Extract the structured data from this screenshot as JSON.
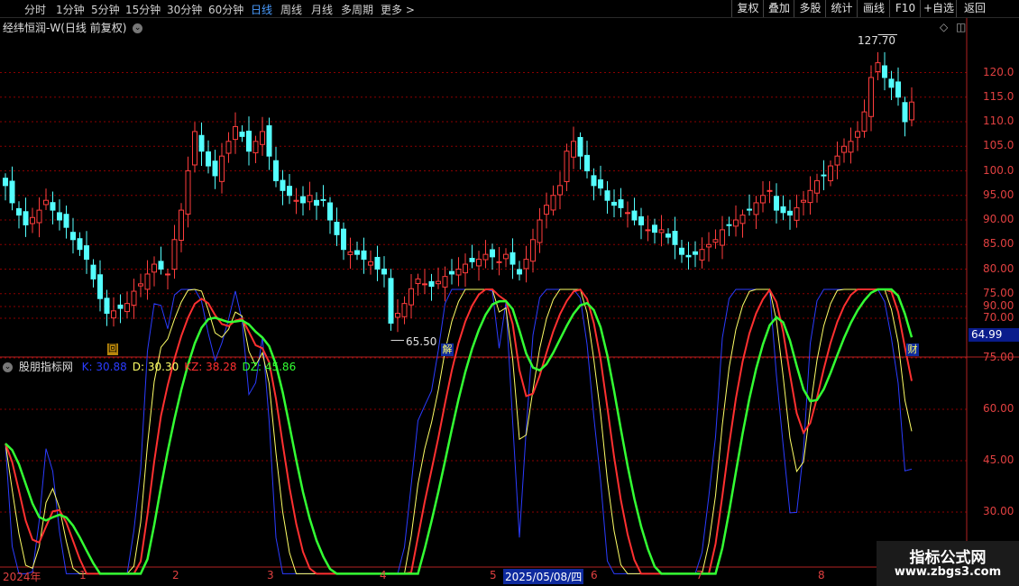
{
  "toolbar": {
    "periods": [
      "分时",
      "1分钟",
      "5分钟",
      "15分钟",
      "30分钟",
      "60分钟",
      "日线",
      "周线",
      "月线",
      "多周期",
      "更多 >"
    ],
    "active_period": "日线",
    "right_buttons": [
      "复权",
      "叠加",
      "多股",
      "统计",
      "画线",
      "F10",
      "+自选",
      "返回"
    ]
  },
  "main_panel": {
    "title": "经纬恒润-W(日线 前复权)",
    "high_marker": "127.70",
    "low_marker": "65.50",
    "current_price": "64.99",
    "price_ticks": [
      "120.0",
      "115.0",
      "110.0",
      "105.0",
      "100.0",
      "95.00",
      "90.00",
      "85.00",
      "80.00",
      "75.00",
      "70.00"
    ],
    "event_markers": [
      "回",
      "解",
      "财"
    ]
  },
  "indicator_panel": {
    "name": "股朋指标网",
    "values": [
      {
        "label": "K: 30.88",
        "color": "#2b3cff"
      },
      {
        "label": "D: 30.30",
        "color": "#ffff66"
      },
      {
        "label": "KZ: 38.28",
        "color": "#ff3030"
      },
      {
        "label": "DZ: 45.86",
        "color": "#33ff33"
      }
    ],
    "ticks": [
      "90.00",
      "75.00",
      "60.00",
      "45.00",
      "30.00"
    ]
  },
  "date_axis": {
    "labels": [
      "2024年",
      "1",
      "2",
      "3",
      "4",
      "5",
      "2025/05/08/四",
      "6",
      "7",
      "8"
    ]
  },
  "watermark": {
    "line1": "指标公式网",
    "line2": "www.zbgs3.com"
  },
  "colors": {
    "up": "#ff3d3d",
    "down": "#54ffff",
    "grid": "#8b0000",
    "axis": "#b22222"
  },
  "chart_data": {
    "type": "candlestick",
    "close": [
      97,
      93.5,
      91,
      89,
      90.5,
      92,
      94,
      92,
      90,
      88.5,
      86,
      84,
      82,
      78,
      74,
      71,
      71.5,
      72,
      73,
      75.5,
      77,
      79,
      81,
      80,
      79,
      86,
      92,
      100,
      108,
      104,
      101,
      99,
      103,
      106,
      109,
      107,
      104,
      106,
      108,
      103,
      98,
      96,
      95,
      94,
      93.5,
      95,
      93,
      94,
      90,
      87,
      84,
      83.5,
      83,
      82,
      81.5,
      80,
      79,
      69,
      71,
      73,
      76,
      78,
      77,
      76.5,
      77.5,
      78.5,
      79,
      80,
      81,
      81.5,
      82,
      83,
      82.5,
      81.5,
      83,
      81,
      79,
      82,
      86,
      90,
      93,
      95,
      97,
      104,
      106,
      103,
      100,
      97,
      96.5,
      94,
      93,
      92.5,
      91.5,
      90,
      89,
      88,
      87.5,
      88,
      86.5,
      85,
      83,
      82.5,
      83,
      84,
      85,
      86,
      88,
      89,
      90,
      91,
      92,
      93.5,
      95,
      96,
      92,
      91.5,
      91,
      92.5,
      94,
      96,
      98,
      99,
      101,
      103,
      105,
      106,
      108,
      112,
      119,
      122,
      119,
      117,
      115,
      110,
      114
    ],
    "ylim": [
      65,
      130
    ]
  }
}
